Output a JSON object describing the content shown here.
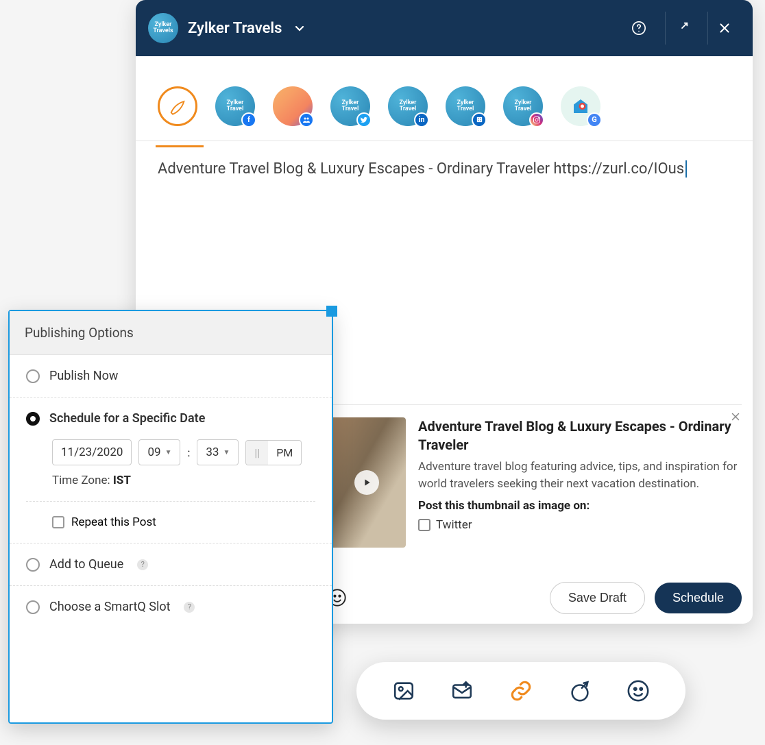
{
  "header": {
    "brand_name": "Zylker Travels",
    "avatar_text": "Zylker\nTravels"
  },
  "channels": [
    {
      "id": "compose",
      "label": "",
      "badge": ""
    },
    {
      "id": "facebook",
      "label": "Zylker Travel",
      "badge": "f"
    },
    {
      "id": "group",
      "label": "",
      "badge": "grp"
    },
    {
      "id": "twitter",
      "label": "Zylker Travel",
      "badge": "tw"
    },
    {
      "id": "linkedin",
      "label": "Zylker Travel",
      "badge": "in"
    },
    {
      "id": "linkedin_company",
      "label": "Zylker Travel",
      "badge": "co"
    },
    {
      "id": "instagram",
      "label": "Zylker Travel",
      "badge": "ig"
    },
    {
      "id": "gmb",
      "label": "",
      "badge": "G"
    }
  ],
  "editor": {
    "text": "Adventure Travel Blog & Luxury Escapes - Ordinary Traveler https://zurl.co/IOus"
  },
  "preview": {
    "title": "Adventure Travel Blog & Luxury Escapes - Ordinary Traveler",
    "description": "Adventure travel blog featuring advice, tips, and inspiration for world travelers seeking their next vacation destination.",
    "post_as_label": "Post this thumbnail as image on:",
    "twitter_option": "Twitter"
  },
  "footer": {
    "save_draft": "Save Draft",
    "schedule": "Schedule"
  },
  "publishing": {
    "title": "Publishing Options",
    "publish_now": "Publish Now",
    "schedule_specific": "Schedule for a Specific Date",
    "date": "11/23/2020",
    "hour": "09",
    "minute": "33",
    "am": "||",
    "pm": "PM",
    "tz_label": "Time Zone: ",
    "tz_value": "IST",
    "repeat": "Repeat this Post",
    "add_queue": "Add to Queue",
    "smartq": "Choose a SmartQ Slot"
  }
}
